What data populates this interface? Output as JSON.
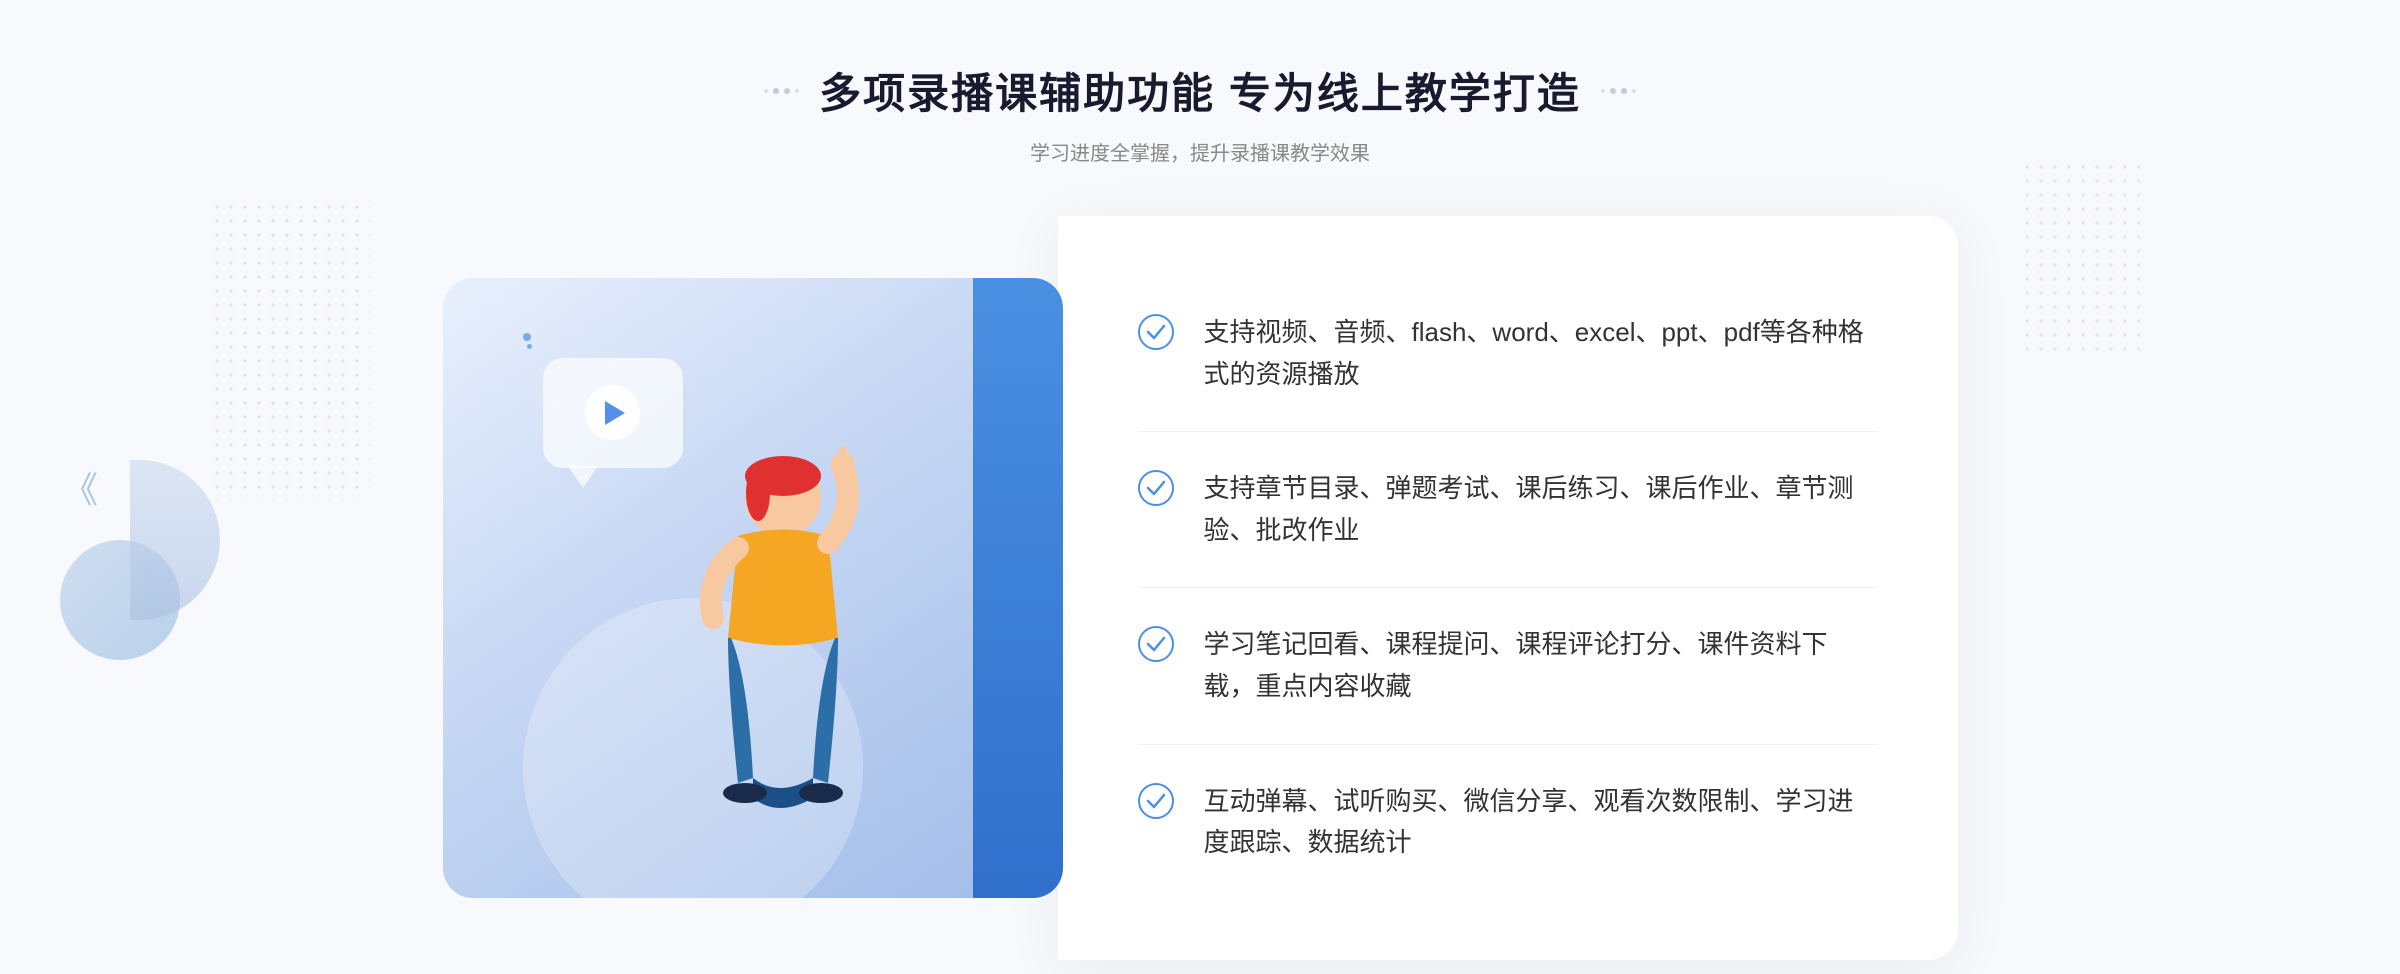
{
  "page": {
    "background": "#f8f9fc"
  },
  "header": {
    "title": "多项录播课辅助功能 专为线上教学打造",
    "subtitle": "学习进度全掌握，提升录播课教学效果",
    "decorator_left": "decorative dots left",
    "decorator_right": "decorative dots right"
  },
  "features": [
    {
      "id": 1,
      "text": "支持视频、音频、flash、word、excel、ppt、pdf等各种格式的资源播放"
    },
    {
      "id": 2,
      "text": "支持章节目录、弹题考试、课后练习、课后作业、章节测验、批改作业"
    },
    {
      "id": 3,
      "text": "学习笔记回看、课程提问、课程评论打分、课件资料下载，重点内容收藏"
    },
    {
      "id": 4,
      "text": "互动弹幕、试听购买、微信分享、观看次数限制、学习进度跟踪、数据统计"
    }
  ],
  "illustration": {
    "alt": "Online teaching illustration with person pointing"
  },
  "icons": {
    "check_circle": "✓",
    "play": "▶",
    "chevron_left": "《"
  },
  "colors": {
    "primary_blue": "#4a90e2",
    "check_color": "#4a90e2",
    "title_color": "#1a1a2e",
    "text_color": "#333333",
    "subtitle_color": "#888888"
  }
}
